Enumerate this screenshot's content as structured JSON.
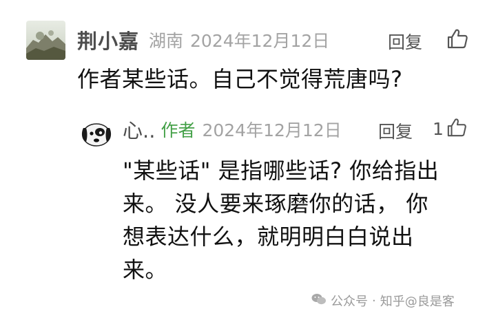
{
  "top_comment": {
    "username": "荆小嘉",
    "location": "湖南",
    "date": "2024年12月12日",
    "reply_label": "回复",
    "like_icon": "thumbs-up-icon",
    "text": "作者某些话。自己不觉得荒唐吗?"
  },
  "reply_comment": {
    "username": "心..",
    "author_badge": "作者",
    "date": "2024年12月12日",
    "reply_label": "回复",
    "like_count": "1",
    "like_icon": "thumbs-up-icon",
    "text_lines": [
      "\"某些话\" 是指哪些话? 你给指出",
      "来。 没人要来琢磨你的话， 你",
      "想表达什么，就明明白白说出",
      "来。"
    ]
  },
  "watermark": {
    "icon": "wechat-icon",
    "account_label": "公众号",
    "separator": "·",
    "name": "知乎@良是客"
  },
  "colors": {
    "author_badge": "#43a047",
    "meta_gray": "#a3a3a3",
    "username_gray": "#4d4d4d"
  }
}
